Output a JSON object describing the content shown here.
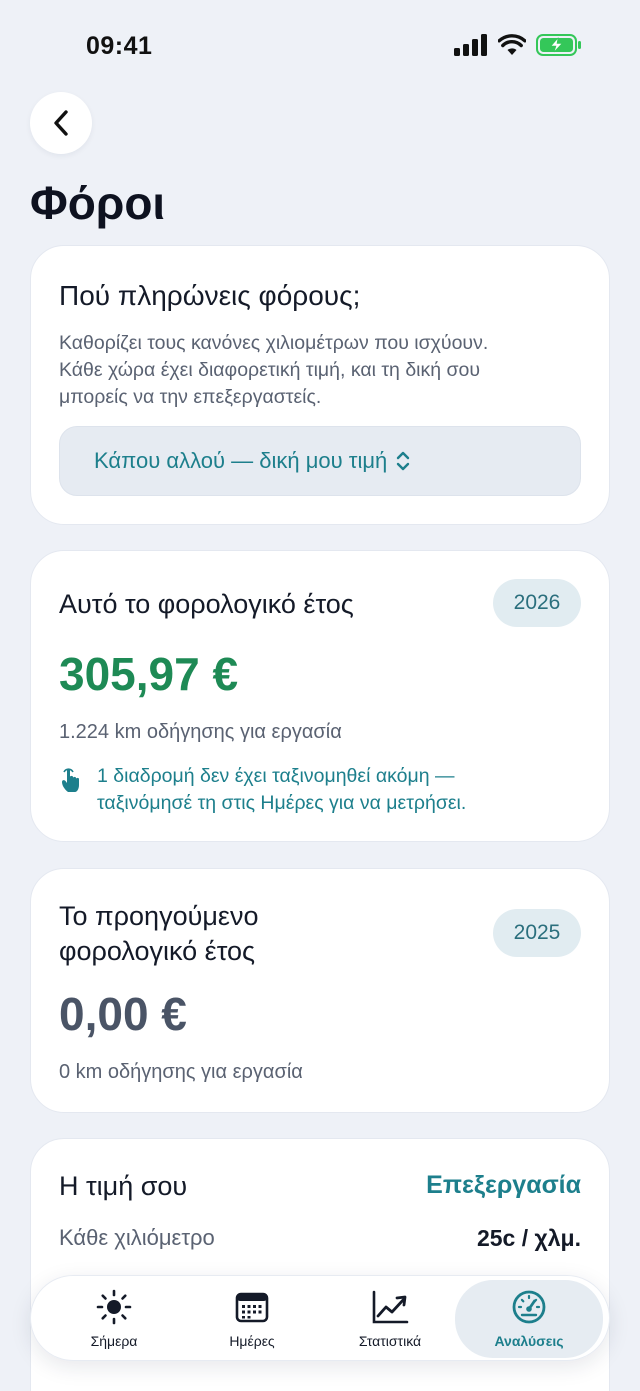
{
  "status": {
    "time": "09:41"
  },
  "header": {
    "title": "Φόροι"
  },
  "tax_country": {
    "title": "Πού πληρώνεις φόρους;",
    "description_lines": [
      "Καθορίζει τους κανόνες χιλιομέτρων που ισχύουν.",
      "Κάθε χώρα έχει διαφορετική τιμή, και τη δική σου",
      "μπορείς να την επεξεργαστείς."
    ],
    "selected": "Κάπου αλλού — δική μου τιμή"
  },
  "current_year": {
    "title": "Αυτό το φορολογικό έτος",
    "year": "2026",
    "amount": "305,97 €",
    "km_text": "1.224 km οδήγησης για εργασία",
    "hint_lines": [
      "1 διαδρομή δεν έχει ταξινομηθεί ακόμη —",
      "ταξινόμησέ τη στις Ημέρες για να μετρήσει."
    ]
  },
  "previous_year": {
    "title_lines": [
      "Το προηγούμενο",
      "φορολογικό έτος"
    ],
    "year": "2025",
    "amount": "0,00 €",
    "km_text": "0 km οδήγησης για εργασία"
  },
  "rate": {
    "title": "Η τιμή σου",
    "edit_label": "Επεξεργασία",
    "per_km_label": "Κάθε χιλιόμετρο",
    "per_km_value": "25c / χλμ."
  },
  "tabs": [
    {
      "label": "Σήμερα",
      "icon": "sun-icon",
      "active": false
    },
    {
      "label": "Ημέρες",
      "icon": "calendar-icon",
      "active": false
    },
    {
      "label": "Στατιστικά",
      "icon": "chart-icon",
      "active": false
    },
    {
      "label": "Αναλύσεις",
      "icon": "gauge-icon",
      "active": true
    }
  ],
  "colors": {
    "accent": "#1d7f8c",
    "amount_green": "#1e8a55",
    "amount_gray": "#4a5466",
    "battery": "#34c759"
  }
}
